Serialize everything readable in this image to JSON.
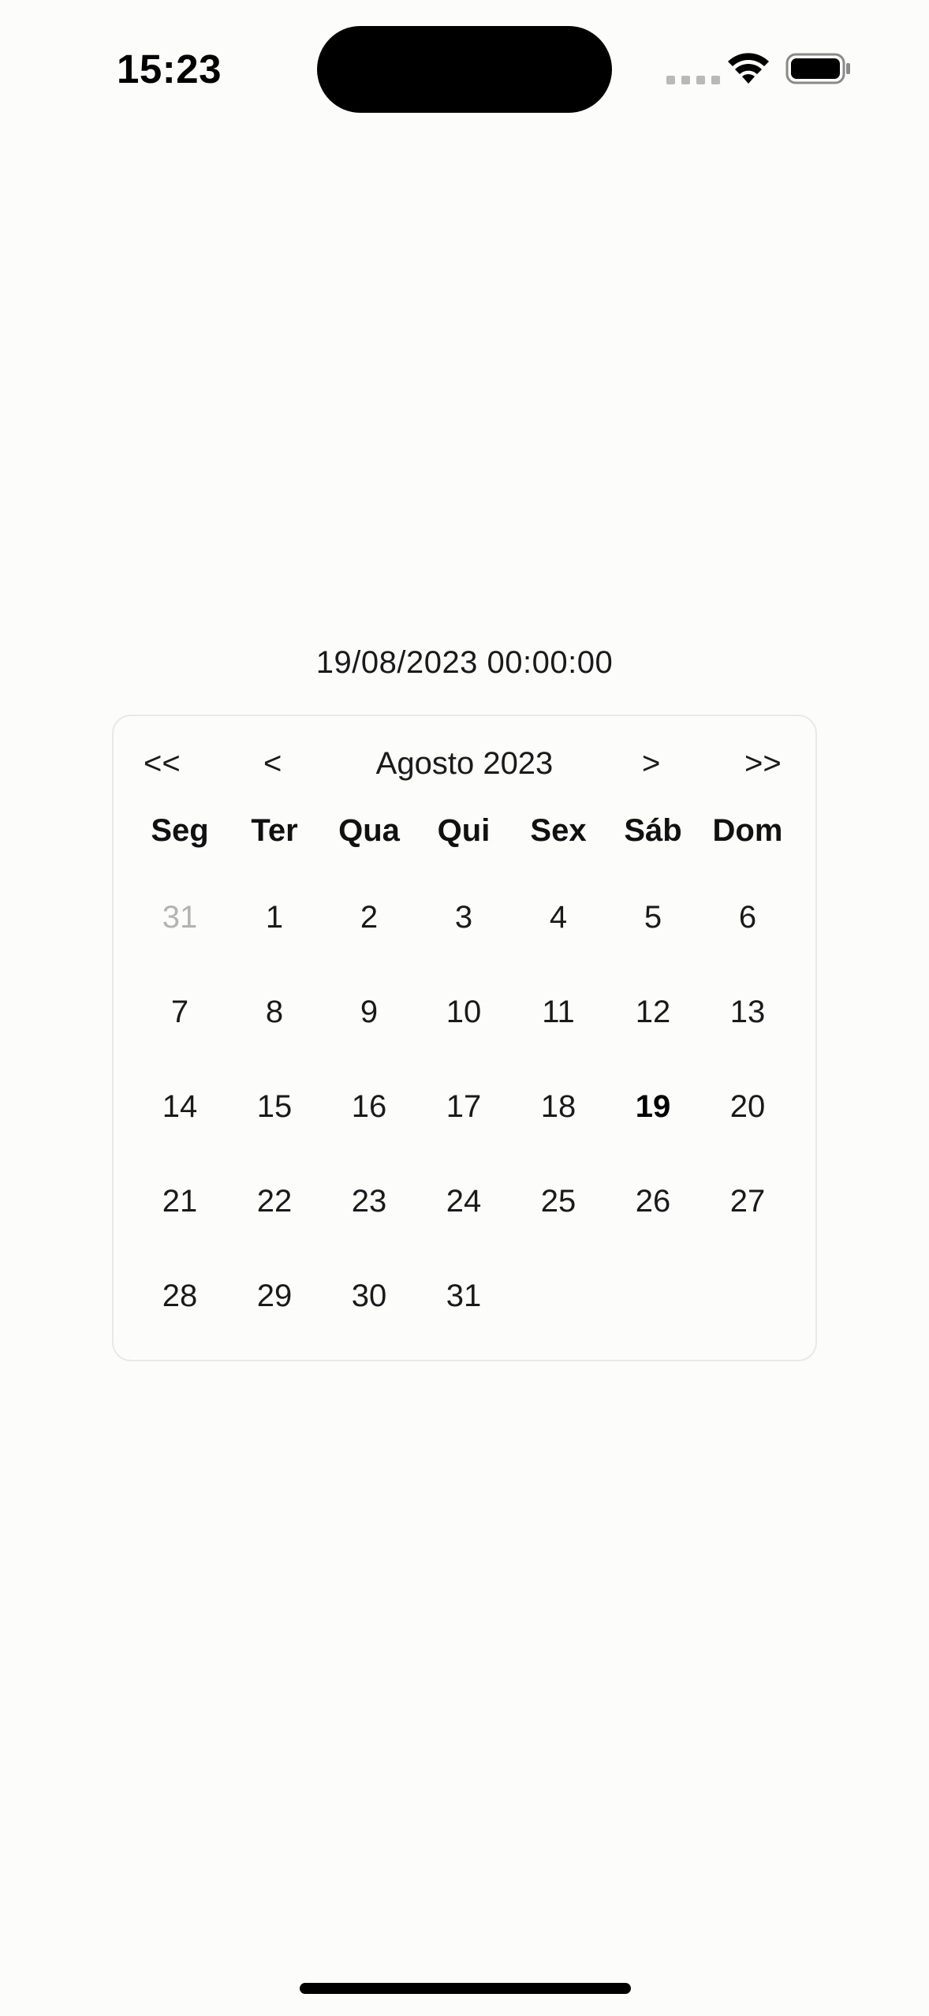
{
  "status_bar": {
    "time": "15:23",
    "icons": [
      "signal-icon",
      "wifi-icon",
      "battery-icon"
    ]
  },
  "selected_date_text": "19/08/2023 00:00:00",
  "calendar": {
    "nav": {
      "first": "<<",
      "prev": "<",
      "month_label": "Agosto 2023",
      "next": ">",
      "last": ">>"
    },
    "weekdays": [
      "Seg",
      "Ter",
      "Qua",
      "Qui",
      "Sex",
      "Sáb",
      "Dom"
    ],
    "weeks": [
      [
        {
          "d": "31",
          "muted": true
        },
        {
          "d": "1"
        },
        {
          "d": "2"
        },
        {
          "d": "3"
        },
        {
          "d": "4"
        },
        {
          "d": "5"
        },
        {
          "d": "6"
        }
      ],
      [
        {
          "d": "7"
        },
        {
          "d": "8"
        },
        {
          "d": "9"
        },
        {
          "d": "10"
        },
        {
          "d": "11"
        },
        {
          "d": "12"
        },
        {
          "d": "13"
        }
      ],
      [
        {
          "d": "14"
        },
        {
          "d": "15"
        },
        {
          "d": "16"
        },
        {
          "d": "17"
        },
        {
          "d": "18"
        },
        {
          "d": "19",
          "selected": true
        },
        {
          "d": "20"
        }
      ],
      [
        {
          "d": "21"
        },
        {
          "d": "22"
        },
        {
          "d": "23"
        },
        {
          "d": "24"
        },
        {
          "d": "25"
        },
        {
          "d": "26"
        },
        {
          "d": "27"
        }
      ],
      [
        {
          "d": "28"
        },
        {
          "d": "29"
        },
        {
          "d": "30"
        },
        {
          "d": "31"
        }
      ]
    ]
  },
  "colors": {
    "background": "#fcfcfb",
    "text": "#1a1a1a",
    "muted_text": "#b3b3b3",
    "border": "#e9e9e9"
  }
}
